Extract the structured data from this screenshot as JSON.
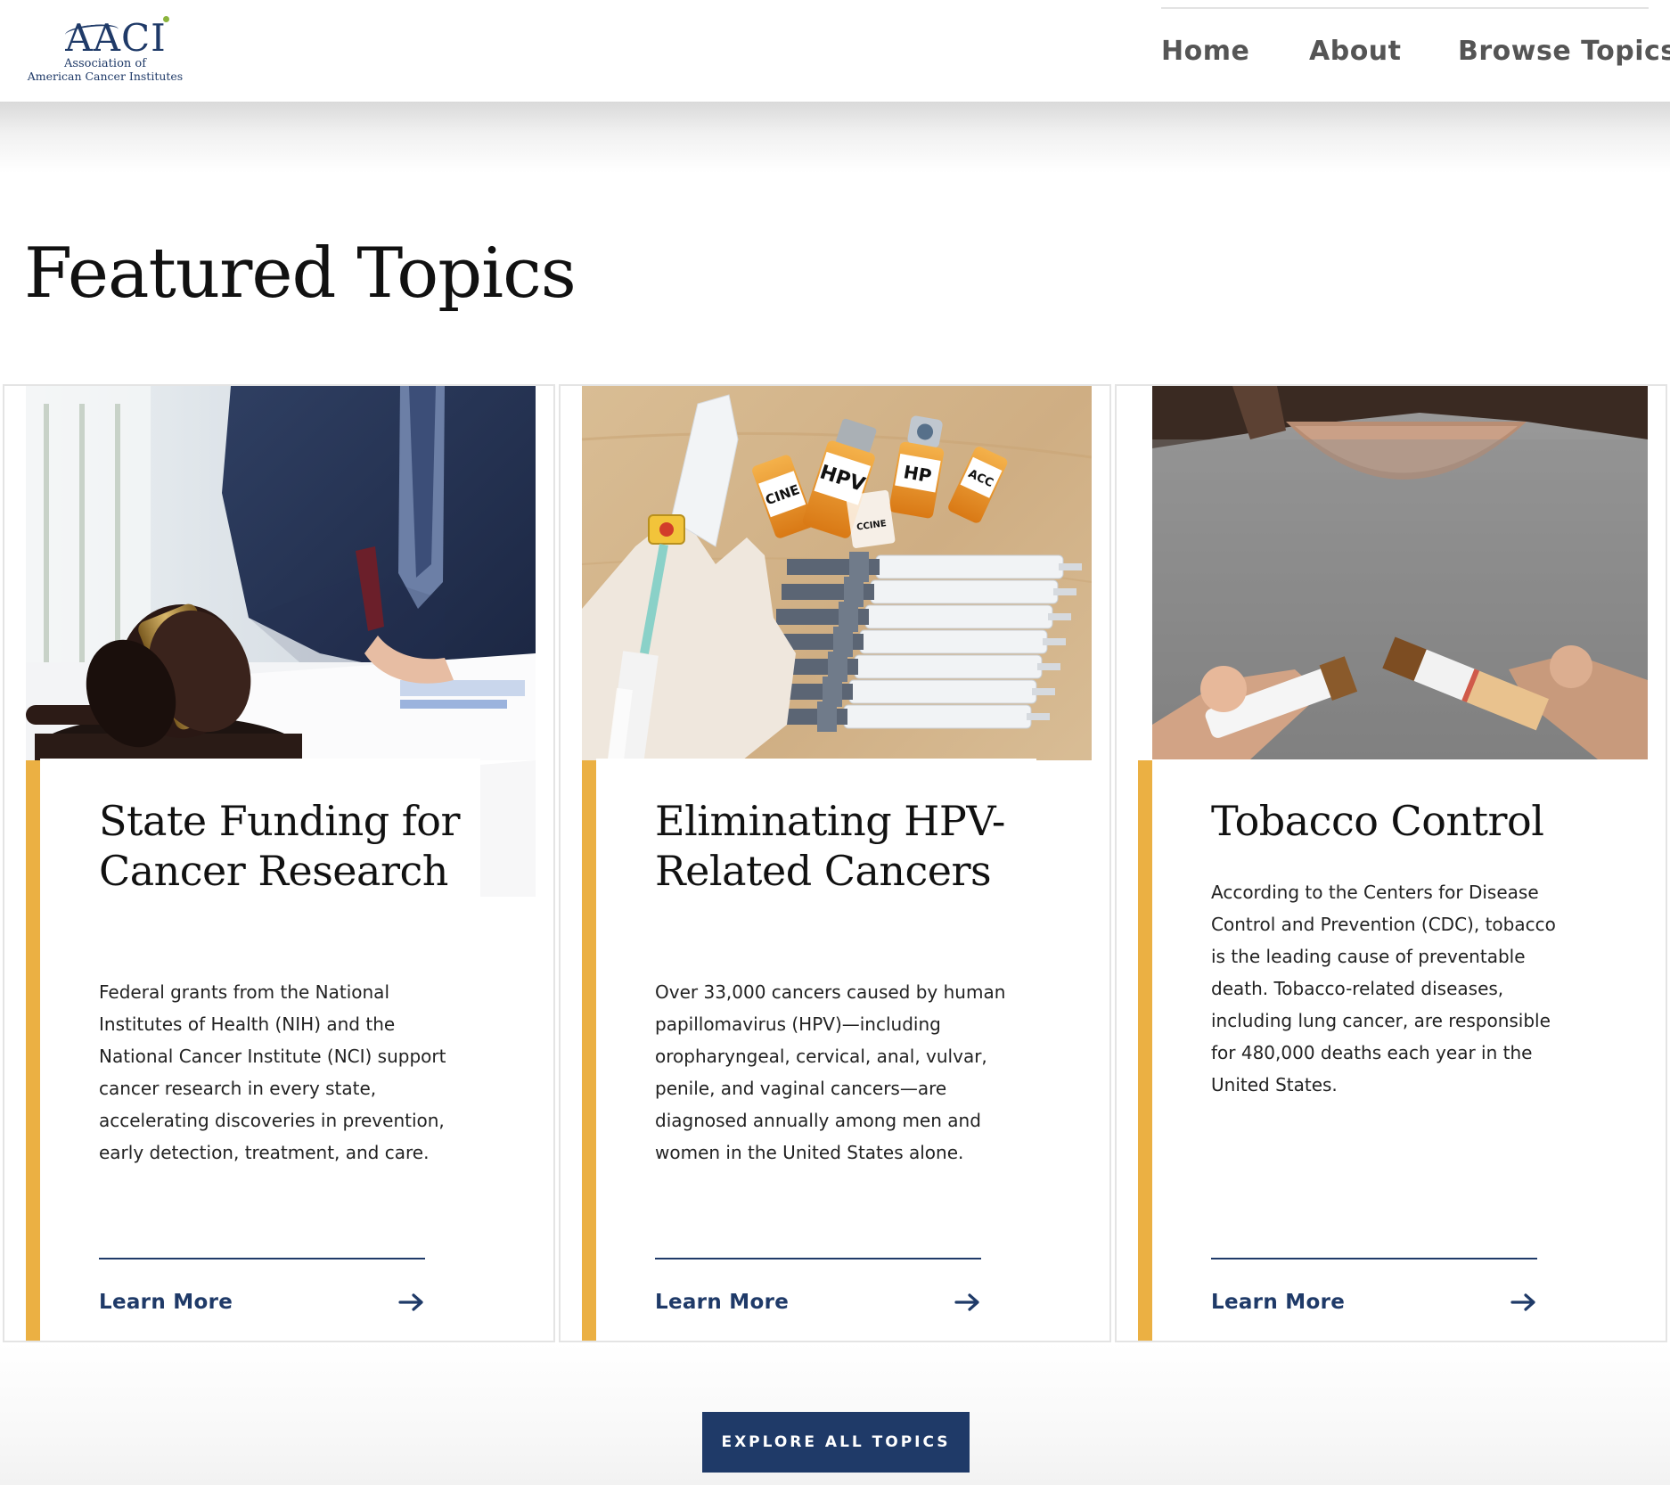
{
  "header": {
    "logo": {
      "mark": "AACI",
      "line1": "Association of",
      "line2": "American Cancer Institutes"
    },
    "nav": [
      {
        "label": "Home"
      },
      {
        "label": "About"
      },
      {
        "label": "Browse Topics"
      }
    ]
  },
  "main": {
    "section_title": "Featured Topics",
    "cards": [
      {
        "title": "State Funding for Cancer Research",
        "description": "Federal grants from the National Institutes of Health (NIH) and the National Cancer Institute (NCI) support cancer research in every state, accelerating discoveries in prevention, early detection, treatment, and care.",
        "link_label": "Learn More"
      },
      {
        "title": "Eliminating HPV-Related Cancers",
        "description": "Over 33,000 cancers caused by human papillomavirus (HPV)—including oropharyngeal, cervical, anal, vulvar, penile, and vaginal cancers—are diagnosed annually among men and women in the United States alone.",
        "link_label": "Learn More",
        "image_text": {
          "vial1": "HPV",
          "vial2": "HP",
          "vial3": "CINE",
          "vial4": "ACC",
          "vial5": "CCINE"
        }
      },
      {
        "title": "Tobacco Control",
        "description": "According to the Centers for Disease Control and Prevention (CDC), tobacco is the leading cause of preventable death. Tobacco-related diseases, including lung cancer, are responsible for 480,000 deaths each year in the United States.",
        "link_label": "Learn More"
      }
    ],
    "cta_label": "EXPLORE ALL TOPICS"
  },
  "icons": {
    "arrow": "arrow-right-icon"
  },
  "colors": {
    "accent": "#ebb043",
    "brand_navy": "#1f3a68",
    "logo_dot": "#8bb43c"
  }
}
